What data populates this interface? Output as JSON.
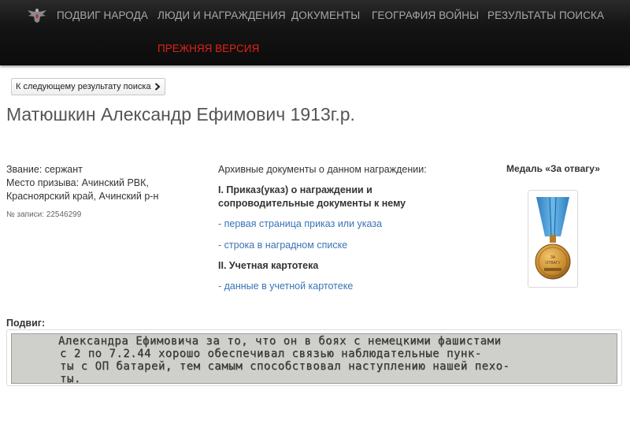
{
  "nav": {
    "items": [
      "ПОДВИГ НАРОДА",
      "ЛЮДИ И НАГРАЖДЕНИЯ",
      "ДОКУМЕНТЫ",
      "ГЕОГРАФИЯ ВОЙНЫ",
      "РЕЗУЛЬТАТЫ ПОИСКА"
    ],
    "old_version": "ПРЕЖНЯЯ ВЕРСИЯ",
    "text_color": "#a8a8a8",
    "old_version_color": "#e3211b"
  },
  "next_button": {
    "label": "К следующему результату поиска",
    "icon": "chevron-right-icon"
  },
  "person": {
    "name": "Матюшкин Александр Ефимович 1913г.р.",
    "rank": "Звание: сержант",
    "draft_line1": "Место призыва: Ачинский РВК,",
    "draft_line2": "Красноярский край, Ачинский р-н",
    "record": "№ записи: 22546299"
  },
  "documents": {
    "heading": "Архивные документы о данном награждении:",
    "section1_line1": "I. Приказ(указ) о награждении и",
    "section1_line2": "сопроводительные документы к нему",
    "link1": "- первая страница приказ или указа",
    "link2": "- строка в наградном списке",
    "section2": "II. Учетная картотека",
    "link3": "- данные в учетной картотеке",
    "link_color": "#3a73b5"
  },
  "medal": {
    "title": "Медаль «За отвагу»",
    "icon": "medal-za-otvagu-icon"
  },
  "feat": {
    "label": "Подвиг:",
    "line1": "Александра Ефимовича за то, что он в боях с немецкими фашистами",
    "line2": "с 2 по 7.2.44 хорошо обеспечивал связью наблюдательные пунк-",
    "line3": "ты с ОП батарей, тем самым способствовал наступлению нашей пехо-",
    "line4": "ты."
  }
}
